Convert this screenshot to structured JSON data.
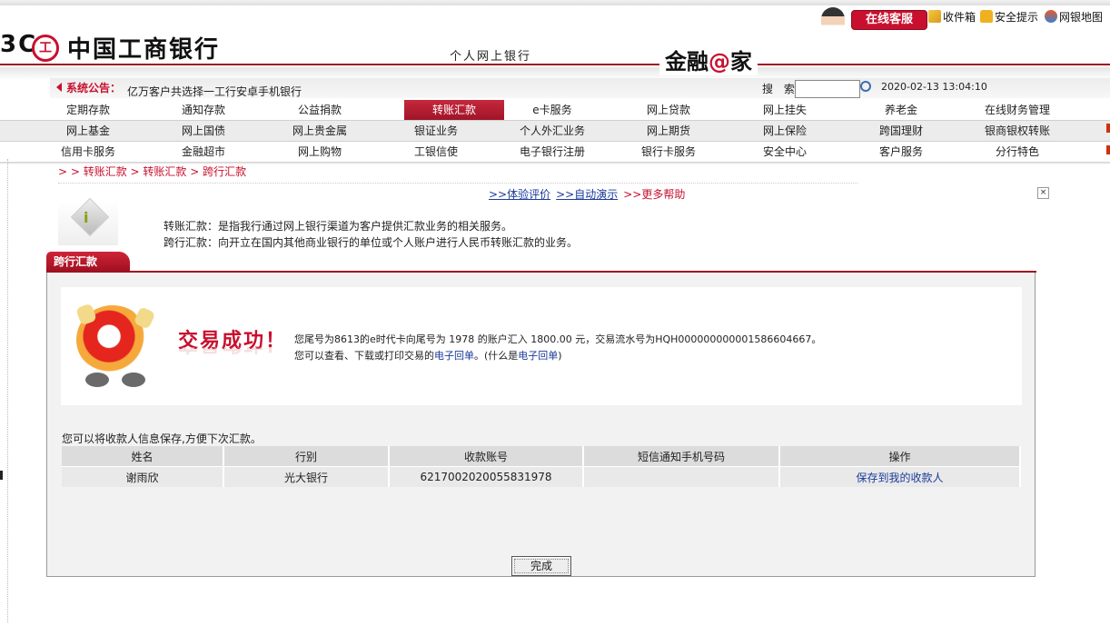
{
  "header": {
    "logo_partial": "3C",
    "bank_name": "中国工商银行",
    "logo_mark": "工",
    "personal_banking": "个人网上银行",
    "brand_slogan_pre": "金融",
    "brand_slogan_at": "@",
    "brand_slogan_post": "家",
    "online_service": "在线客服",
    "links": [
      "收件箱",
      "安全提示",
      "网银地图"
    ]
  },
  "notice": {
    "title": "系统公告：",
    "text": "亿万客户共选择一工行安卓手机银行",
    "search_label": "搜 索",
    "search_value": "",
    "datetime": "2020-02-13 13:04:10"
  },
  "menu": {
    "row1": [
      "定期存款",
      "通知存款",
      "公益捐款",
      "转账汇款",
      "e卡服务",
      "网上贷款",
      "网上挂失",
      "养老金",
      "在线财务管理"
    ],
    "row2": [
      "网上基金",
      "网上国债",
      "网上贵金属",
      "银证业务",
      "个人外汇业务",
      "网上期货",
      "网上保险",
      "跨国理财",
      "银商银权转账"
    ],
    "row3": [
      "信用卡服务",
      "金融超市",
      "网上购物",
      "工银信使",
      "电子银行注册",
      "银行卡服务",
      "安全中心",
      "客户服务",
      "分行特色"
    ],
    "active": "转账汇款"
  },
  "breadcrumb": "> > 转账汇款 > 转账汇款 > 跨行汇款",
  "help": {
    "experience": ">>体验评价",
    "demo": ">>自动演示",
    "more": ">>更多帮助",
    "close": "×"
  },
  "info": {
    "line1": "转账汇款：是指我行通过网上银行渠道为客户提供汇款业务的相关服务。",
    "line2": "跨行汇款：向开立在国内其他商业银行的单位或个人账户进行人民币转账汇款的业务。"
  },
  "panel": {
    "tab_title": "跨行汇款",
    "success_title": "交易成功！",
    "msg1": "您尾号为8613的e时代卡向尾号为 1978  的账户汇入 1800.00 元，交易流水号为HQH000000000001586604667。",
    "msg2_pre": "您可以查看、下载或打印交易的",
    "msg2_link1": "电子回单",
    "msg2_mid": "。(什么是",
    "msg2_link2": "电子回单",
    "msg2_post": ")",
    "save_hint": "您可以将收款人信息保存,方便下次汇款。",
    "table": {
      "headers": [
        "姓名",
        "行别",
        "收款账号",
        "短信通知手机号码",
        "操作"
      ],
      "row": [
        "谢雨欣",
        "光大银行",
        "6217002020055831978",
        "",
        "保存到我的收款人"
      ]
    },
    "done_button": "完成"
  },
  "colors": {
    "brand_red": "#c8102e",
    "link_blue": "#1a3a9a"
  }
}
